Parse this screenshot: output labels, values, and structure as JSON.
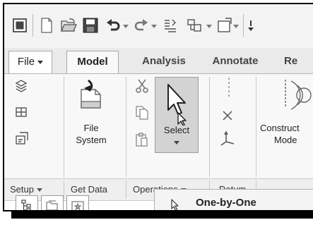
{
  "ribbon_tabs": {
    "file": "File",
    "model": "Model",
    "analysis": "Analysis",
    "annotate": "Annotate",
    "render_partial": "Re"
  },
  "ribbon_buttons": {
    "file_system": [
      "File",
      "System"
    ],
    "select": "Select",
    "construct_mode": [
      "Construct",
      "Mode"
    ]
  },
  "group_labels": {
    "setup": "Setup",
    "get_data": "Get Data",
    "operations": "Operations",
    "datum": "Datum"
  },
  "popup_menu": {
    "first_item": "One-by-One"
  },
  "colors": {
    "select_button_bg": "#d3d3d3",
    "ribbon_bg": "#f8f8f8"
  }
}
